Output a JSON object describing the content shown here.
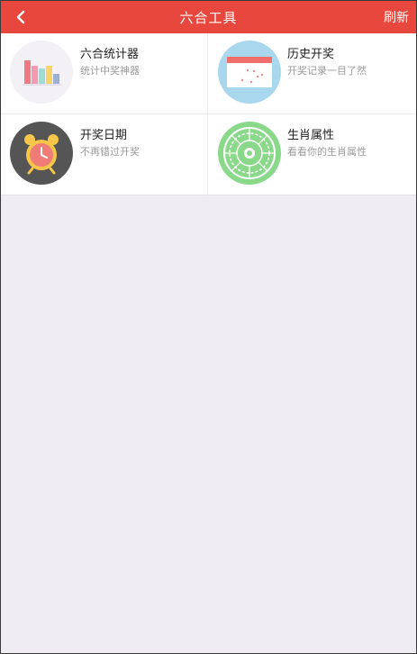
{
  "navbar": {
    "title": "六合工具",
    "refresh_label": "刷新",
    "back_icon": "chevron-left-icon",
    "color": "#e8473d"
  },
  "tools": [
    {
      "title": "六合统计器",
      "subtitle": "统计中奖神器",
      "icon": "bar-chart-icon"
    },
    {
      "title": "历史开奖",
      "subtitle": "开奖记录一目了然",
      "icon": "calendar-icon"
    },
    {
      "title": "开奖日期",
      "subtitle": "不再错过开奖",
      "icon": "alarm-clock-icon"
    },
    {
      "title": "生肖属性",
      "subtitle": "看看你的生肖属性",
      "icon": "zodiac-wheel-icon"
    }
  ]
}
